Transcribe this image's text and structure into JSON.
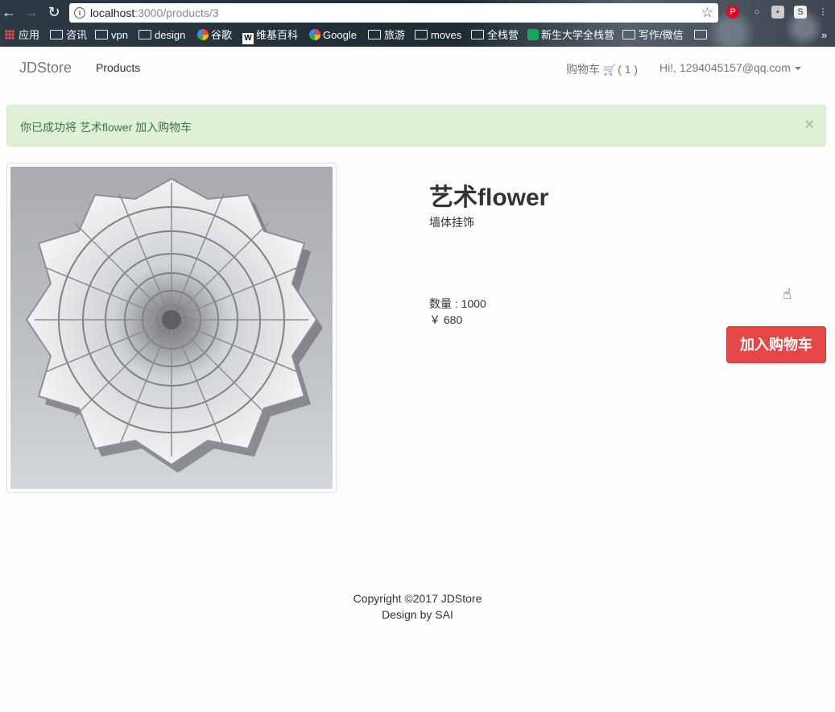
{
  "browser": {
    "back_icon": "arrow-left-icon",
    "forward_icon": "arrow-right-icon",
    "reload_icon": "reload-icon",
    "url_host": "localhost",
    "url_path": ":3000/products/3",
    "bookmarks": [
      {
        "label": "应用",
        "icon": "apps-icon"
      },
      {
        "label": "咨讯",
        "icon": "folder-icon"
      },
      {
        "label": "vpn",
        "icon": "folder-icon"
      },
      {
        "label": "design",
        "icon": "folder-icon"
      },
      {
        "label": "谷歌",
        "icon": "google-icon"
      },
      {
        "label": "维基百科",
        "icon": "wikipedia-icon"
      },
      {
        "label": "Google",
        "icon": "google-icon"
      },
      {
        "label": "旅游",
        "icon": "folder-icon"
      },
      {
        "label": "moves",
        "icon": "folder-icon"
      },
      {
        "label": "全栈营",
        "icon": "folder-icon"
      },
      {
        "label": "新生大学全栈营",
        "icon": "bookmark-icon"
      },
      {
        "label": "写作/微信",
        "icon": "folder-icon"
      }
    ]
  },
  "navbar": {
    "brand": "JDStore",
    "products": "Products",
    "cart_label": "购物车",
    "cart_count": "( 1 )",
    "user": "Hi!, 1294045157@qq.com"
  },
  "alert": {
    "message": "你已成功将 艺术flower 加入购物车",
    "close": "×"
  },
  "product": {
    "title": "艺术flower",
    "description": "墙体挂饰",
    "quantity": "数量 : 1000",
    "price": "￥ 680",
    "add_to_cart": "加入购物车"
  },
  "footer": {
    "copyright": "Copyright ©2017 JDStore",
    "design": "Design by SAI"
  },
  "colors": {
    "alert_bg": "#dff0d8",
    "alert_text": "#3c763d",
    "button_red": "#e54646"
  }
}
